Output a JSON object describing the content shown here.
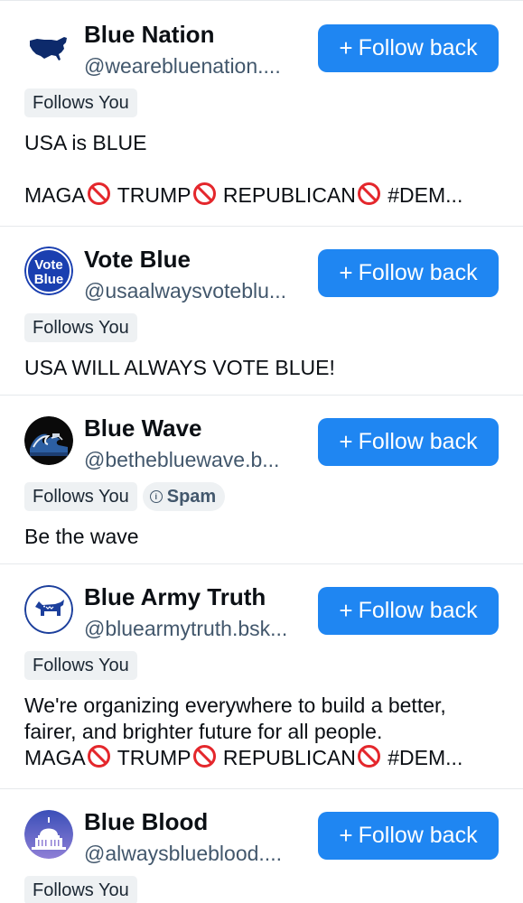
{
  "follow_button_label": "Follow back",
  "follow_button_icon": "plus-icon",
  "colors": {
    "button_bg": "#1f86f2",
    "badge_bg": "#eef1f3",
    "handle_text": "#42576c",
    "prohibited_sign": "#e4272c"
  },
  "accounts": [
    {
      "name": "Blue Nation",
      "handle": "@wearebluenation....",
      "avatar_icon": "usa-map-avatar",
      "badges": [
        "Follows You"
      ],
      "bio": {
        "line1": "USA is BLUE",
        "line3_words": [
          "MAGA",
          "TRUMP",
          "REPUBLICAN"
        ],
        "line3_tail": "#DEM..."
      }
    },
    {
      "name": "Vote Blue",
      "handle": "@usaalwaysvoteblu...",
      "avatar_icon": "vote-blue-avatar",
      "avatar_text": [
        "Vote",
        "Blue"
      ],
      "badges": [
        "Follows You"
      ],
      "bio": {
        "line1": "USA WILL ALWAYS VOTE BLUE!"
      }
    },
    {
      "name": "Blue Wave",
      "handle": "@bethebluewave.b...",
      "avatar_icon": "great-wave-avatar",
      "badges": [
        "Follows You"
      ],
      "spam_label": "Spam",
      "bio": {
        "line1": "Be the wave"
      }
    },
    {
      "name": "Blue Army Truth",
      "handle": "@bluearmytruth.bsk...",
      "avatar_icon": "democrat-donkey-avatar",
      "badges": [
        "Follows You"
      ],
      "bio": {
        "line1": "We're organizing everywhere to build a better,",
        "line2": "fairer, and brighter future for all people.",
        "line3_words": [
          "MAGA",
          "TRUMP",
          "REPUBLICAN"
        ],
        "line3_tail": "#DEM..."
      }
    },
    {
      "name": "Blue Blood",
      "handle": "@alwaysblueblood....",
      "avatar_icon": "capitol-dome-avatar",
      "badges": [
        "Follows You"
      ]
    }
  ]
}
